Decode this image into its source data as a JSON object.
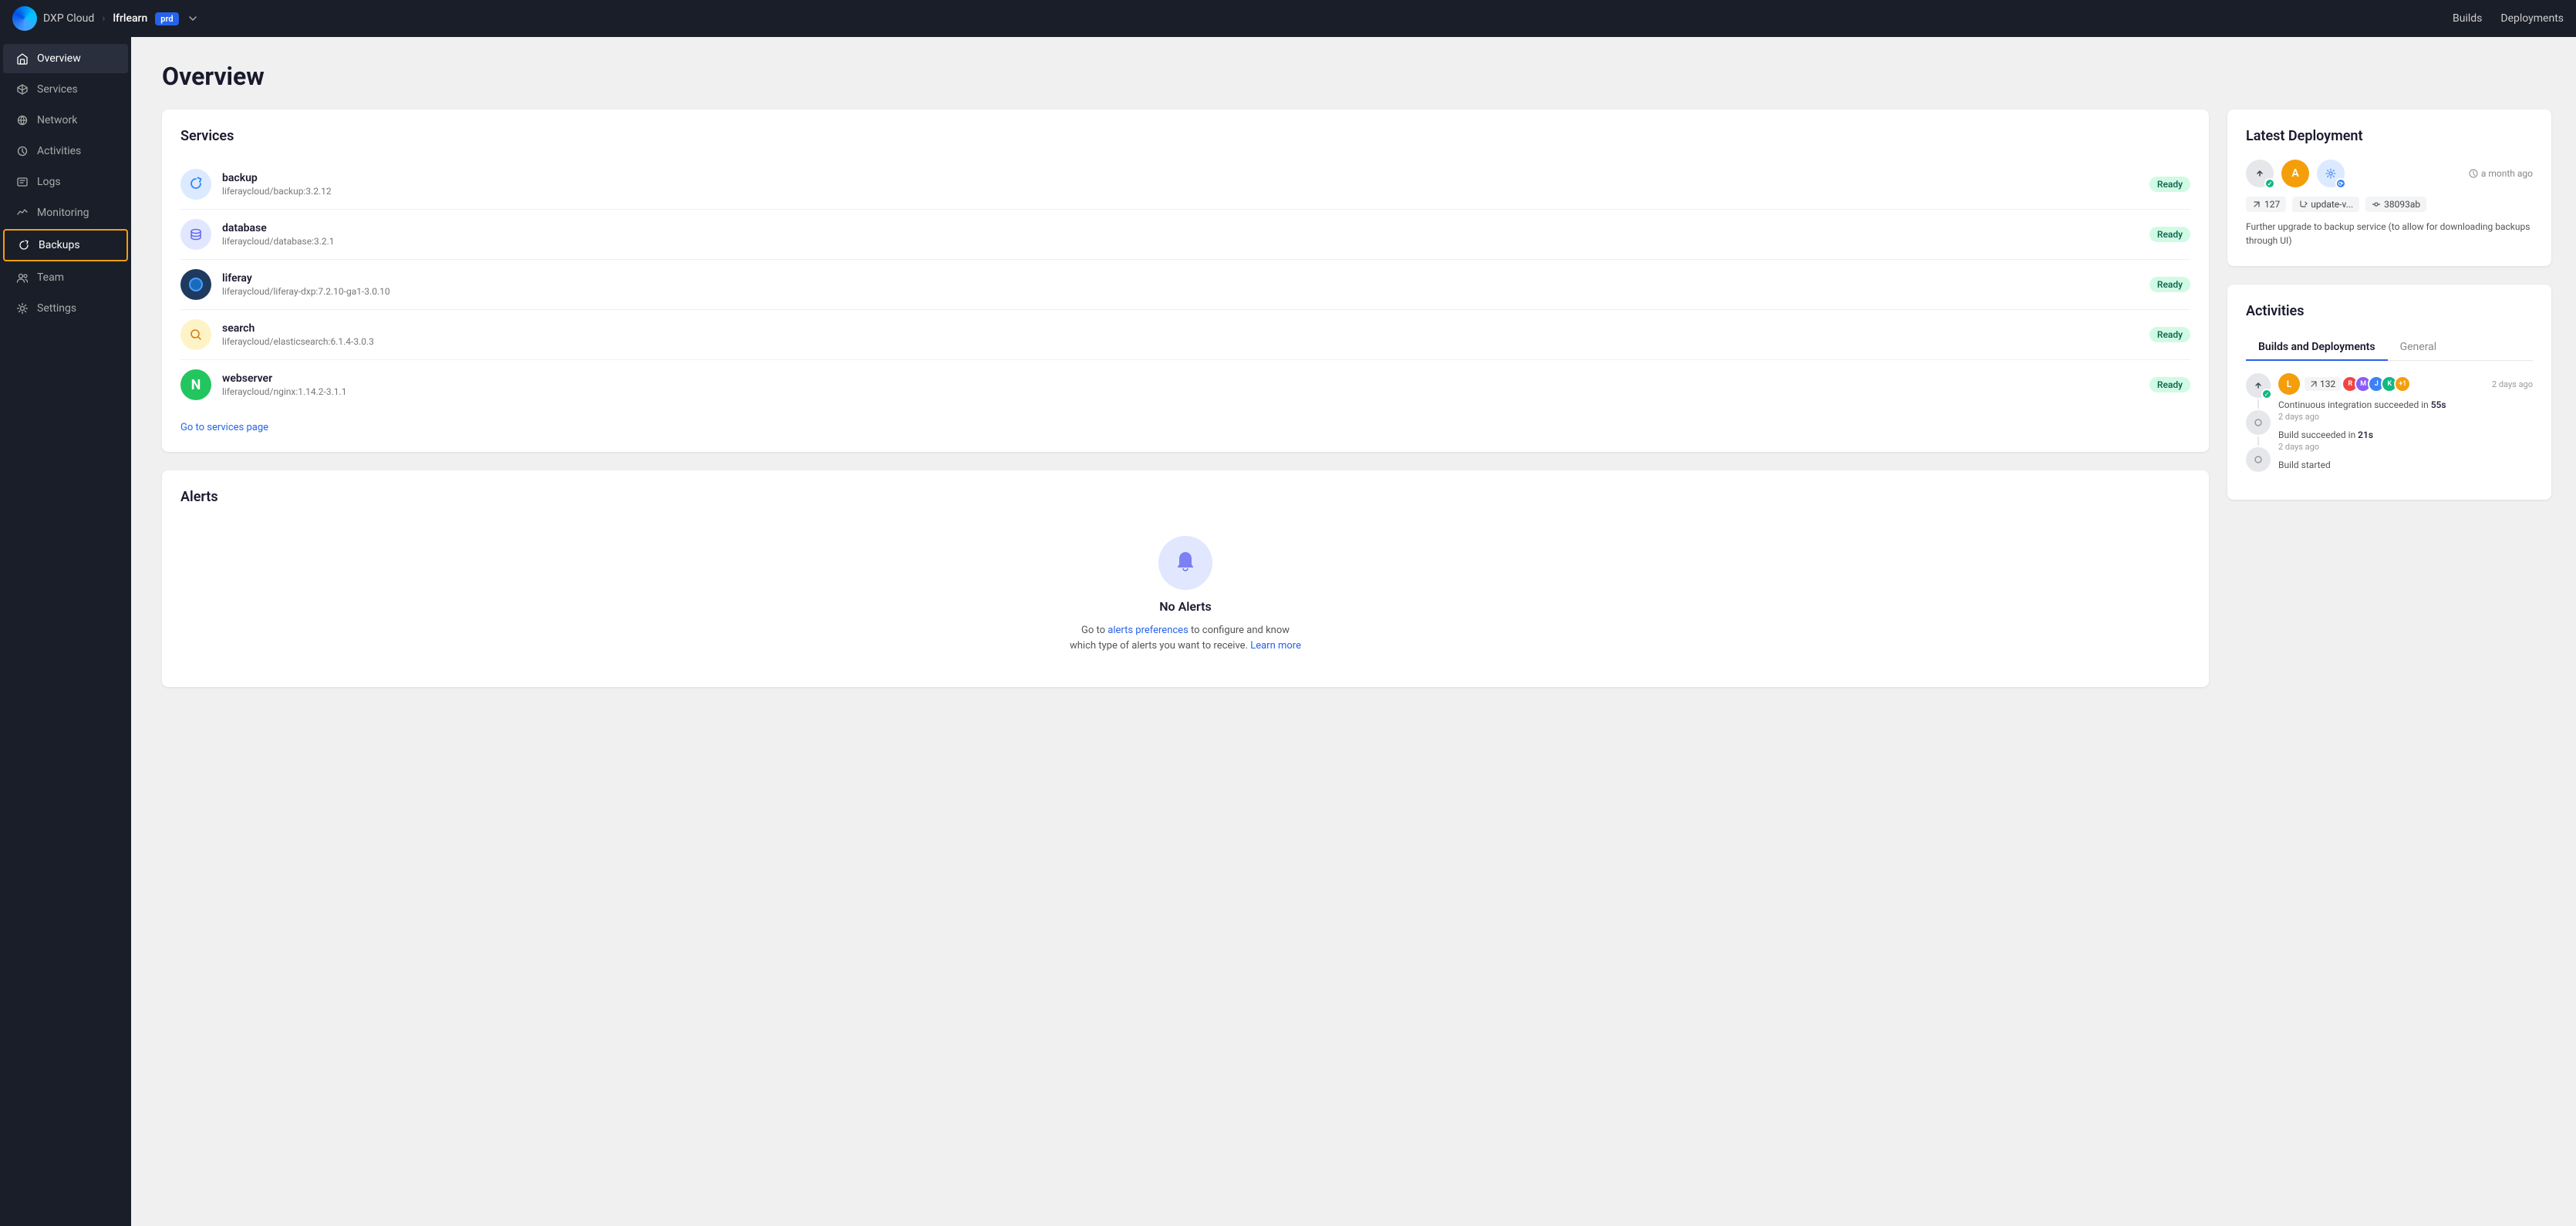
{
  "topnav": {
    "brand": "DXP Cloud",
    "separator": "›",
    "project": "lfrlearn",
    "env_badge": "prd",
    "nav_links": [
      "Builds",
      "Deployments"
    ]
  },
  "sidebar": {
    "items": [
      {
        "id": "overview",
        "label": "Overview",
        "icon": "home",
        "active": true
      },
      {
        "id": "services",
        "label": "Services",
        "icon": "cube"
      },
      {
        "id": "network",
        "label": "Network",
        "icon": "network"
      },
      {
        "id": "activities",
        "label": "Activities",
        "icon": "activity"
      },
      {
        "id": "logs",
        "label": "Logs",
        "icon": "logs"
      },
      {
        "id": "monitoring",
        "label": "Monitoring",
        "icon": "monitoring"
      },
      {
        "id": "backups",
        "label": "Backups",
        "icon": "backups",
        "selected": true
      },
      {
        "id": "team",
        "label": "Team",
        "icon": "team"
      },
      {
        "id": "settings",
        "label": "Settings",
        "icon": "settings"
      }
    ]
  },
  "page": {
    "title": "Overview"
  },
  "services_card": {
    "title": "Services",
    "services": [
      {
        "name": "backup",
        "image": "liferaycloud/backup:3.2.12",
        "status": "Ready",
        "icon_bg": "#dbeafe",
        "icon": "🔄"
      },
      {
        "name": "database",
        "image": "liferaycloud/database:3.2.1",
        "status": "Ready",
        "icon_bg": "#e0e7ff",
        "icon": "🗄"
      },
      {
        "name": "liferay",
        "image": "liferaycloud/liferay-dxp:7.2.10-ga1-3.0.10",
        "status": "Ready",
        "icon_bg": "#1e3a5f",
        "icon": "⬤"
      },
      {
        "name": "search",
        "image": "liferaycloud/elasticsearch:6.1.4-3.0.3",
        "status": "Ready",
        "icon_bg": "#fef3c7",
        "icon": "🔍"
      },
      {
        "name": "webserver",
        "image": "liferaycloud/nginx:1.14.2-3.1.1",
        "status": "Ready",
        "icon_bg": "#d1fae5",
        "icon": "N"
      }
    ],
    "go_to_link": "Go to services page"
  },
  "alerts_card": {
    "title": "Alerts",
    "no_alerts_title": "No Alerts",
    "no_alerts_text": "Go to alerts preferences to configure and know which type of alerts you want to receive.",
    "alerts_link": "alerts preferences",
    "learn_more": "Learn more"
  },
  "latest_deployment": {
    "title": "Latest Deployment",
    "time": "a month ago",
    "build_num": "127",
    "branch": "update-v...",
    "commit": "38093ab",
    "message": "Further upgrade to backup service (to allow for downloading backups through UI)"
  },
  "activities": {
    "title": "Activities",
    "tabs": [
      "Builds and Deployments",
      "General"
    ],
    "active_tab": "Builds and Deployments",
    "items": [
      {
        "time": "2 days ago",
        "build_num": "132",
        "ci_text": "Continuous integration succeeded in",
        "ci_duration": "55s",
        "sub_time": "2 days ago",
        "build_text": "Build succeeded in",
        "build_duration": "21s",
        "build_sub_time": "2 days ago"
      }
    ]
  }
}
